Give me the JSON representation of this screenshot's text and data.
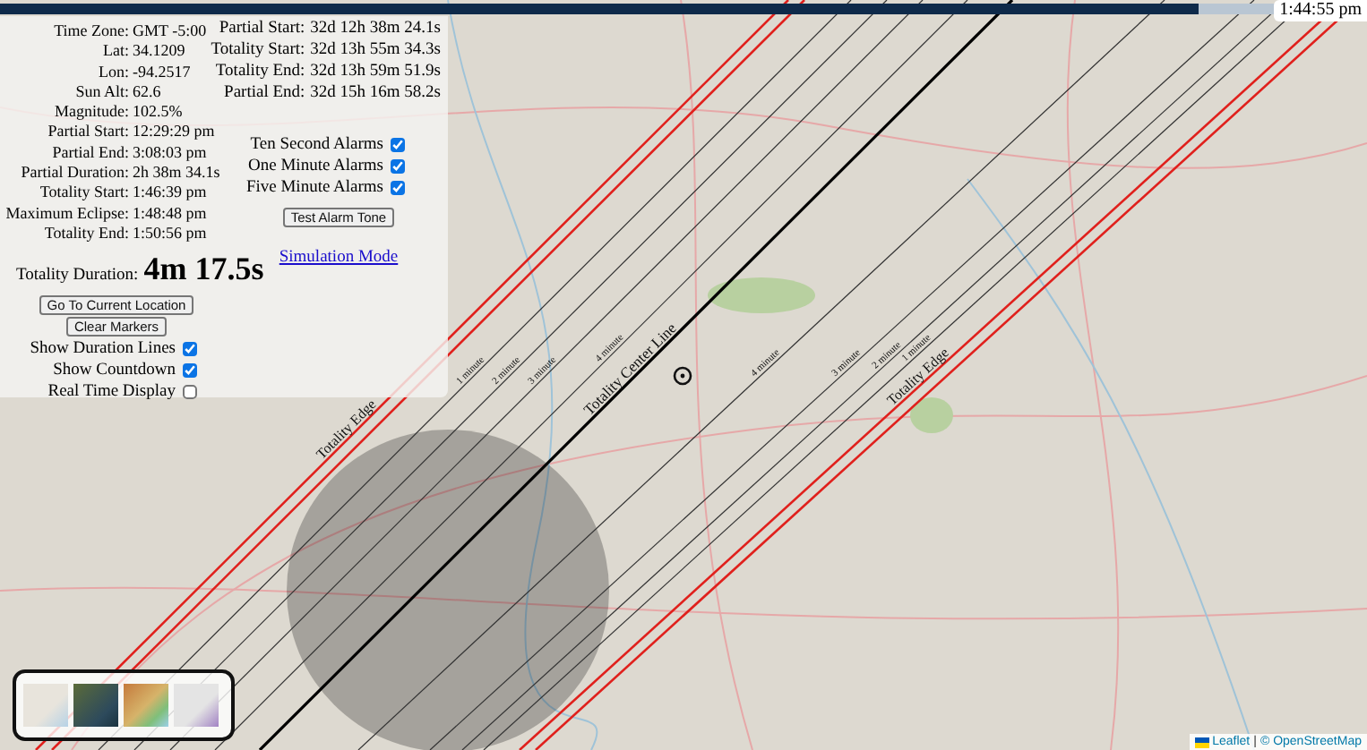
{
  "progress": {
    "level": 0.94,
    "time": "1:44:55 pm"
  },
  "info_panel": {
    "details": [
      {
        "label": "Time Zone:",
        "value": "GMT -5:00"
      },
      {
        "label": "Lat:",
        "value": "34.1209"
      },
      {
        "label": "Lon:",
        "value": "-94.2517"
      },
      {
        "label": "Sun Alt:",
        "value": "62.6"
      },
      {
        "label": "Magnitude:",
        "value": "102.5%"
      },
      {
        "label": "Partial Start:",
        "value": "12:29:29 pm"
      },
      {
        "label": "Partial End:",
        "value": "3:08:03 pm"
      },
      {
        "label": "Partial Duration:",
        "value": "2h 38m 34.1s"
      },
      {
        "label": "Totality Start:",
        "value": "1:46:39 pm"
      },
      {
        "label": "Maximum Eclipse:",
        "value": "1:48:48 pm"
      },
      {
        "label": "Totality End:",
        "value": "1:50:56 pm"
      }
    ],
    "totality_duration": {
      "label": "Totality Duration:",
      "value": "4m 17.5s"
    },
    "buttons": [
      "Go To Current Location",
      "Clear Markers"
    ],
    "toggles": [
      {
        "label": "Show Duration Lines",
        "checked": true
      },
      {
        "label": "Show Countdown",
        "checked": true
      },
      {
        "label": "Real Time Display",
        "checked": false
      }
    ],
    "countdowns": [
      {
        "label": "Partial Start:",
        "value": "32d 12h 38m 24.1s"
      },
      {
        "label": "Totality Start:",
        "value": "32d 13h 55m 34.3s"
      },
      {
        "label": "Totality End:",
        "value": "32d 13h 59m 51.9s"
      },
      {
        "label": "Partial End:",
        "value": "32d 15h 16m 58.2s"
      }
    ],
    "alarms": [
      {
        "label": "Ten Second Alarms",
        "checked": true
      },
      {
        "label": "One Minute Alarms",
        "checked": true
      },
      {
        "label": "Five Minute Alarms",
        "checked": true
      }
    ],
    "test_button": "Test Alarm Tone",
    "simulation_link": "Simulation Mode"
  },
  "map": {
    "path_lines": [
      {
        "kind": "edge",
        "label": "Totality Edge"
      },
      {
        "kind": "minute",
        "label": "1 minute"
      },
      {
        "kind": "minute",
        "label": "2 minute"
      },
      {
        "kind": "minute",
        "label": "3 minute"
      },
      {
        "kind": "minute",
        "label": "4 minute"
      },
      {
        "kind": "center",
        "label": "Totality Center Line"
      },
      {
        "kind": "minute",
        "label": "4 minute"
      },
      {
        "kind": "minute",
        "label": "3 minute"
      },
      {
        "kind": "minute",
        "label": "2 minute"
      },
      {
        "kind": "minute",
        "label": "1 minute"
      },
      {
        "kind": "edge",
        "label": "Totality Edge"
      }
    ]
  },
  "attribution": {
    "leaflet": "Leaflet",
    "separator": "|",
    "osm": "© OpenStreetMap"
  }
}
